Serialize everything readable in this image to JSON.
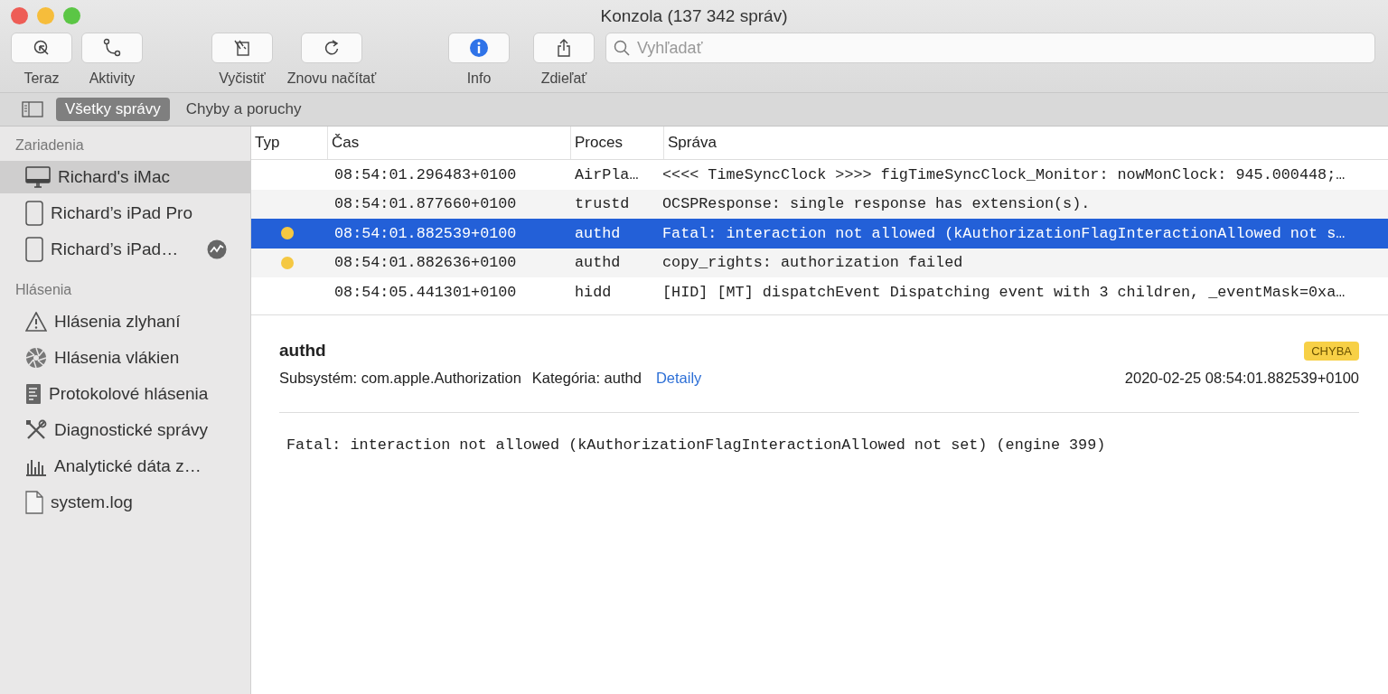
{
  "window": {
    "title": "Konzola (137 342 správ)"
  },
  "toolbar": {
    "buttons": [
      {
        "kind": "now",
        "label": "Teraz"
      },
      {
        "kind": "activity",
        "label": "Aktivity"
      },
      {
        "kind": "clear",
        "label": "Vyčistiť"
      },
      {
        "kind": "reload",
        "label": "Znovu načítať"
      },
      {
        "kind": "info",
        "label": "Info"
      },
      {
        "kind": "share",
        "label": "Zdieľať"
      }
    ],
    "search": {
      "placeholder": "Vyhľadať"
    }
  },
  "scope_tabs": [
    {
      "label": "Všetky správy",
      "selected": true
    },
    {
      "label": "Chyby a poruchy",
      "selected": false
    }
  ],
  "sidebar": {
    "sections": [
      {
        "title": "Zariadenia",
        "items": [
          {
            "kind": "imac",
            "label": "Richard's iMac",
            "selected": true,
            "activity_badge": false
          },
          {
            "kind": "ipad",
            "label": "Richard’s iPad Pro",
            "selected": false,
            "activity_badge": false
          },
          {
            "kind": "ipad",
            "label": "Richard’s iPad…",
            "selected": false,
            "activity_badge": true
          }
        ]
      },
      {
        "title": "Hlásenia",
        "items": [
          {
            "kind": "warning",
            "label": "Hlásenia zlyhaní",
            "selected": false,
            "activity_badge": false
          },
          {
            "kind": "spin",
            "label": "Hlásenia vlákien",
            "selected": false,
            "activity_badge": false
          },
          {
            "kind": "doc",
            "label": "Protokolové hlásenia",
            "selected": false,
            "activity_badge": false
          },
          {
            "kind": "tools",
            "label": "Diagnostické správy",
            "selected": false,
            "activity_badge": false
          },
          {
            "kind": "chart",
            "label": "Analytické dáta z…",
            "selected": false,
            "activity_badge": false
          },
          {
            "kind": "file",
            "label": "system.log",
            "selected": false,
            "activity_badge": false
          }
        ]
      }
    ]
  },
  "table": {
    "columns": [
      "Typ",
      "Čas",
      "Proces",
      "Správa"
    ],
    "rows": [
      {
        "kind": "default",
        "time": "08:54:01.296483+0100",
        "process": "AirPla…",
        "message": "<<<< TimeSyncClock >>>> figTimeSyncClock_Monitor: nowMonClock: 945.000448;…",
        "selected": false
      },
      {
        "kind": "default",
        "time": "08:54:01.877660+0100",
        "process": "trustd",
        "message": "OCSPResponse: single response has extension(s).",
        "selected": false
      },
      {
        "kind": "error",
        "time": "08:54:01.882539+0100",
        "process": "authd",
        "message": "Fatal: interaction not allowed (kAuthorizationFlagInteractionAllowed not s…",
        "selected": true
      },
      {
        "kind": "error",
        "time": "08:54:01.882636+0100",
        "process": "authd",
        "message": "copy_rights: authorization failed",
        "selected": false
      },
      {
        "kind": "default",
        "time": "08:54:05.441301+0100",
        "process": "hidd",
        "message": "[HID] [MT] dispatchEvent Dispatching event with 3 children, _eventMask=0xa…",
        "selected": false
      }
    ]
  },
  "detail": {
    "process": "authd",
    "badge": "CHYBA",
    "subsystem": "Subsystém: com.apple.Authorization",
    "category": "Kategória: authd",
    "link": "Detaily",
    "timestamp": "2020-02-25 08:54:01.882539+0100",
    "message": "Fatal: interaction not allowed (kAuthorizationFlagInteractionAllowed not set) (engine 399)"
  }
}
